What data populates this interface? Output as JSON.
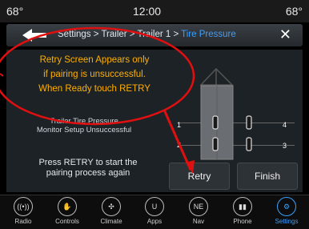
{
  "status": {
    "temp_left": "68°",
    "time": "12:00",
    "temp_right": "68°"
  },
  "header": {
    "breadcrumb_prefix": "Settings > Trailer > Trailer 1 > ",
    "breadcrumb_active": "Tire Pressure",
    "accent": "#3aa0ff"
  },
  "callout": {
    "lines": [
      "Retry Screen Appears only",
      "if pairing is unsuccessful.",
      "When Ready touch RETRY"
    ],
    "color": "#ffb000",
    "outline_color": "#e01010"
  },
  "main": {
    "setup_message": [
      "Trailer Tire Pressure",
      "Monitor Setup Unsuccessful"
    ],
    "instruction": [
      "Press RETRY to start the",
      "pairing process again"
    ],
    "retry_label": "Retry",
    "finish_label": "Finish",
    "tire_numbers": [
      "1",
      "2",
      "3",
      "4"
    ]
  },
  "dock": [
    {
      "label": "Radio",
      "icon": "radio-icon"
    },
    {
      "label": "Controls",
      "icon": "controls-icon"
    },
    {
      "label": "Climate",
      "icon": "climate-icon"
    },
    {
      "label": "Apps",
      "icon": "apps-icon"
    },
    {
      "label": "Nav",
      "icon": "nav-icon"
    },
    {
      "label": "Phone",
      "icon": "phone-icon"
    },
    {
      "label": "Settings",
      "icon": "settings-icon",
      "active": true
    }
  ]
}
